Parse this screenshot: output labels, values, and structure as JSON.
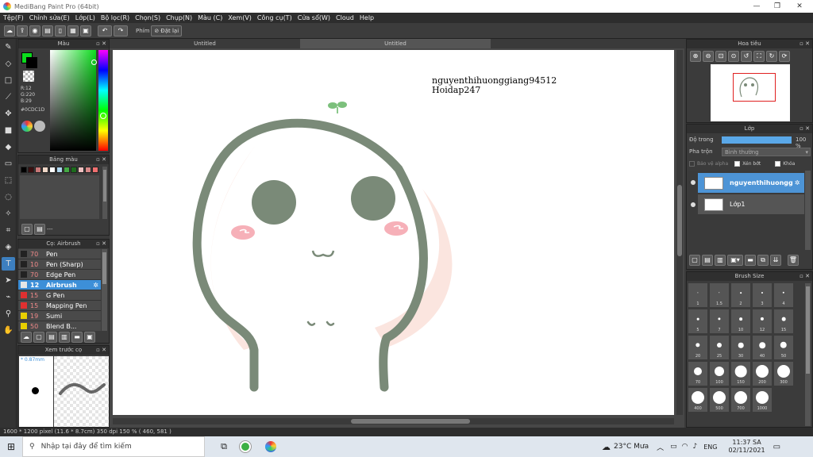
{
  "app": {
    "title": "MediBang Paint Pro (64bit)"
  },
  "menu": [
    "Tệp(F)",
    "Chỉnh sửa(E)",
    "Lớp(L)",
    "Bộ lọc(R)",
    "Chọn(S)",
    "Chụp(N)",
    "Màu (C)",
    "Xem(V)",
    "Công cụ(T)",
    "Cửa sổ(W)",
    "Cloud",
    "Help"
  ],
  "toolbar": {
    "snap_label": "Phím",
    "reset_label": "Đặt lại"
  },
  "tabs": [
    "Untitled",
    "Untitled"
  ],
  "color_panel": {
    "title": "Màu",
    "r": "R:12",
    "g": "G:220",
    "b": "B:29",
    "hex": "#0CDC1D",
    "accent": "#0CDC1D"
  },
  "swatch_panel": {
    "title": "Bảng màu",
    "colors": [
      "#000000",
      "#3a1010",
      "#c87878",
      "#f0d8c8",
      "#ffffff",
      "#b0d8f0",
      "#44aa44",
      "#1c6c1c",
      "#eec0c0",
      "#d88888",
      "#f07070"
    ],
    "footer_text": "---"
  },
  "brush_panel": {
    "title": "Cọ: Airbrush",
    "brushes": [
      {
        "size": "70",
        "name": "Pen",
        "color": "#222222"
      },
      {
        "size": "10",
        "name": "Pen (Sharp)",
        "color": "#222222"
      },
      {
        "size": "70",
        "name": "Edge Pen",
        "color": "#222222"
      },
      {
        "size": "12",
        "name": "Airbrush",
        "color": "#e6e6e6",
        "selected": true
      },
      {
        "size": "15",
        "name": "G Pen",
        "color": "#e03030"
      },
      {
        "size": "15",
        "name": "Mapping Pen",
        "color": "#e03030"
      },
      {
        "size": "19",
        "name": "Sumi",
        "color": "#e8d000"
      },
      {
        "size": "50",
        "name": "Blend B...",
        "color": "#e8d000"
      }
    ]
  },
  "preview_panel": {
    "title": "Xem trước cọ",
    "size_text": "* 0.87mm"
  },
  "canvas": {
    "watermark_line1": "nguyenthihuonggiang94512",
    "watermark_line2": "Hoidap247"
  },
  "status": {
    "text": "1600 * 1200 pixel   (11.6 * 8.7cm)   350 dpi   150 %   ( 460, 581 )"
  },
  "navigator": {
    "title": "Hoa tiêu"
  },
  "layers": {
    "title": "Lớp",
    "opacity_label": "Độ trong",
    "opacity_value": "100 %",
    "blend_label": "Pha trộn",
    "blend_value": "Bình thường",
    "alpha_label": "Bảo vệ alpha",
    "clip_label": "Xén bớt",
    "lock_label": "Khóa",
    "items": [
      {
        "name": "nguyenthihuongg",
        "selected": true
      },
      {
        "name": "Lớp1",
        "selected": false
      }
    ]
  },
  "brush_size": {
    "title": "Brush Size",
    "sizes": [
      "1",
      "1.5",
      "2",
      "3",
      "4",
      "5",
      "7",
      "10",
      "12",
      "15",
      "20",
      "25",
      "30",
      "40",
      "50",
      "70",
      "100",
      "150",
      "200",
      "300",
      "400",
      "500",
      "700",
      "1000"
    ]
  },
  "taskbar": {
    "search_placeholder": "Nhập tại đây để tìm kiếm",
    "weather": "23°C  Mưa",
    "lang": "ENG",
    "time": "11:37 SA",
    "date": "02/11/2021"
  }
}
